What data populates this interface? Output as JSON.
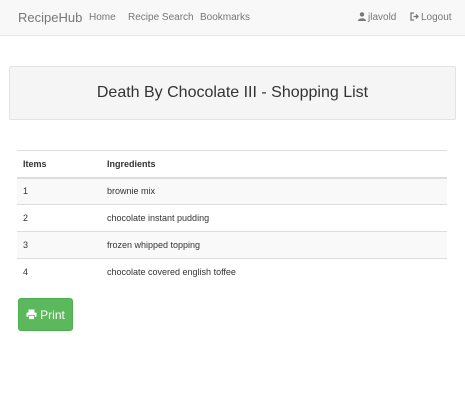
{
  "navbar": {
    "brand": "RecipeHub",
    "links": [
      "Home",
      "Recipe Search",
      "Bookmarks"
    ],
    "user": "jlavold",
    "logout": "Logout"
  },
  "page": {
    "title": "Death By Chocolate III - Shopping List"
  },
  "table": {
    "headers": [
      "Items",
      "Ingredients"
    ],
    "rows": [
      [
        "1",
        "brownie mix"
      ],
      [
        "2",
        "chocolate instant pudding"
      ],
      [
        "3",
        "frozen whipped topping"
      ],
      [
        "4",
        "chocolate covered english toffee"
      ]
    ]
  },
  "print_button": {
    "label": "Print",
    "icon": "print-icon",
    "color": "#5cb85c"
  },
  "icons": {
    "user": "user-icon",
    "logout": "logout-icon"
  }
}
